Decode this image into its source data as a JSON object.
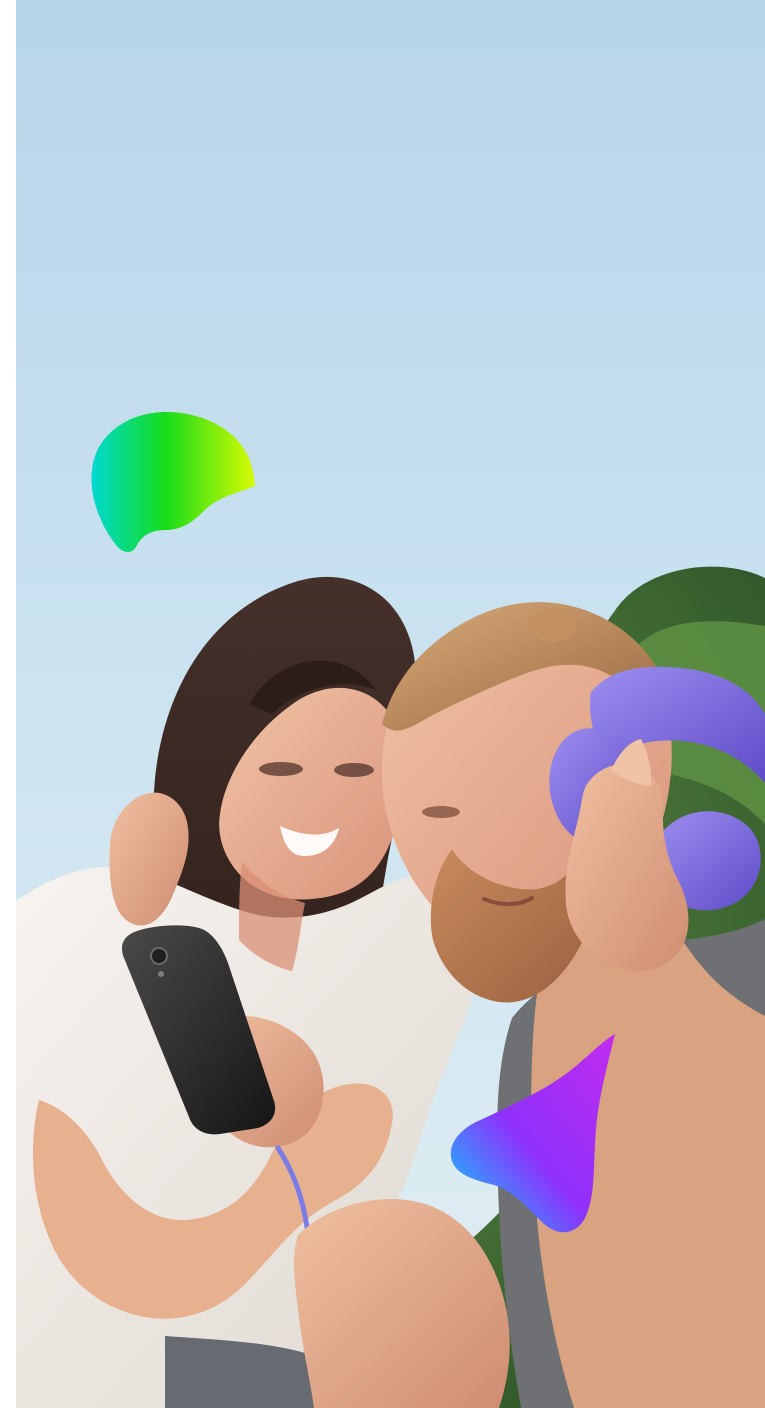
{
  "screen": {
    "type": "photo-onboarding-background"
  },
  "photo": {
    "subject": "couple-listening-to-music-on-smartphone",
    "sky_color": "#cde5f2",
    "foliage_color": "#3f6f33",
    "shirt_color": "#ece7e2",
    "headphones_color": "#7a63db"
  },
  "decorations": [
    {
      "name": "green-gradient-blob",
      "icon": "blob-icon",
      "colors": [
        "#00d9d3",
        "#16dc19",
        "#d8fb02"
      ]
    },
    {
      "name": "purple-gradient-blob",
      "icon": "blob-icon",
      "colors": [
        "#00d8ff",
        "#8e31fb",
        "#c22bee"
      ]
    }
  ]
}
